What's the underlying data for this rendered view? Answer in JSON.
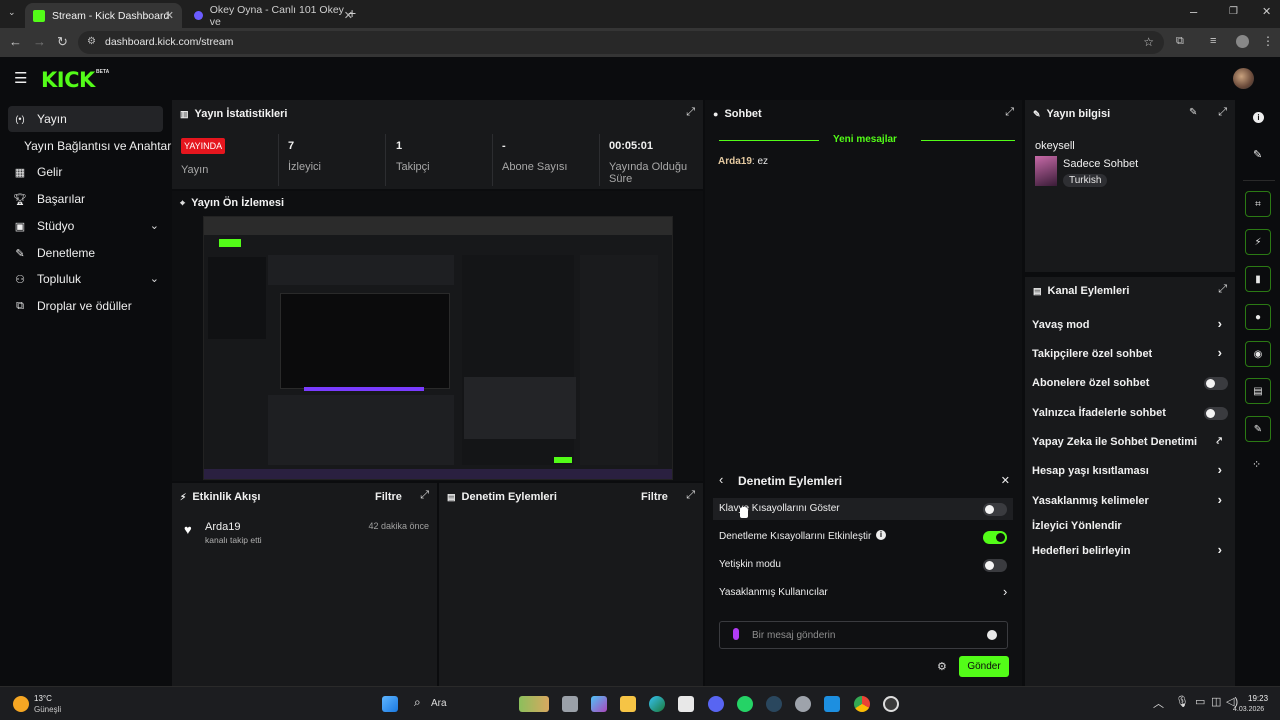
{
  "browser": {
    "tabs": [
      {
        "title": "Stream - Kick Dashboard",
        "active": true
      },
      {
        "title": "Okey Oyna - Canlı 101 Okey ve",
        "active": false
      }
    ],
    "url": "dashboard.kick.com/stream"
  },
  "brand": {
    "logo": "KICK",
    "beta": "BETA",
    "accent": "#53fc18"
  },
  "sidebar": {
    "items": [
      {
        "label": "Yayın",
        "icon": "broadcast-icon",
        "active": true
      },
      {
        "label": "Yayın Bağlantısı ve Anahtarı",
        "icon": "",
        "active": false
      },
      {
        "label": "Gelir",
        "icon": "revenue-icon"
      },
      {
        "label": "Başarılar",
        "icon": "trophy-icon"
      },
      {
        "label": "Stüdyo",
        "icon": "studio-icon",
        "expandable": true
      },
      {
        "label": "Denetleme",
        "icon": "moderation-icon"
      },
      {
        "label": "Topluluk",
        "icon": "community-icon",
        "expandable": true
      },
      {
        "label": "Droplar ve ödüller",
        "icon": "drops-icon"
      }
    ]
  },
  "stats": {
    "title": "Yayın İstatistikleri",
    "live_badge": "YAYINDA",
    "live_label": "Yayın",
    "viewers": {
      "value": "7",
      "label": "İzleyici"
    },
    "followers": {
      "value": "1",
      "label": "Takipçi"
    },
    "subs": {
      "value": "-",
      "label": "Abone Sayısı"
    },
    "uptime": {
      "value": "00:05:01",
      "label": "Yayında Olduğu Süre"
    }
  },
  "preview": {
    "title": "Yayın Ön İzlemesi"
  },
  "activity": {
    "title": "Etkinlik Akışı",
    "filter": "Filtre",
    "items": [
      {
        "user": "Arda19",
        "text": "kanalı takip etti",
        "time": "42 dakika önce"
      }
    ]
  },
  "modlog": {
    "title": "Denetim Eylemleri",
    "filter": "Filtre"
  },
  "chat": {
    "title": "Sohbet",
    "new_messages": "Yeni mesajlar",
    "messages": [
      {
        "user": "Arda19",
        "text": "ez"
      }
    ],
    "mod_panel": {
      "title": "Denetim Eylemleri",
      "rows": [
        {
          "label": "Klavye Kısayollarını Göster",
          "type": "toggle",
          "on": false
        },
        {
          "label": "Denetleme Kısayollarını Etkinleştir",
          "type": "toggle",
          "on": true
        },
        {
          "label": "Yetişkin modu",
          "type": "toggle",
          "on": false
        },
        {
          "label": "Yasaklanmış Kullanıcılar",
          "type": "arrow"
        }
      ]
    },
    "input_placeholder": "Bir mesaj gönderin",
    "send": "Gönder"
  },
  "stream_info": {
    "title": "Yayın bilgisi",
    "stream_title": "okeysell",
    "category": "Sadece Sohbet",
    "tag": "Turkish"
  },
  "channel_actions": {
    "title": "Kanal Eylemleri",
    "rows": [
      {
        "label": "Yavaş mod",
        "type": "arrow"
      },
      {
        "label": "Takipçilere özel sohbet",
        "type": "arrow"
      },
      {
        "label": "Abonelere özel sohbet",
        "type": "toggle",
        "on": false
      },
      {
        "label": "Yalnızca İfadelerle sohbet",
        "type": "toggle",
        "on": false
      },
      {
        "label": "Yapay Zeka ile Sohbet Denetimi",
        "type": "external"
      },
      {
        "label": "Hesap yaşı kısıtlaması",
        "type": "arrow"
      },
      {
        "label": "Yasaklanmış kelimeler",
        "type": "arrow"
      },
      {
        "label": "İzleyici Yönlendir",
        "type": "none"
      },
      {
        "label": "Hedefleri belirleyin",
        "type": "arrow"
      }
    ]
  },
  "taskbar": {
    "weather_temp": "13°C",
    "weather_desc": "Güneşli",
    "search": "Ara",
    "time": "19:23",
    "date": "4.03.2026"
  }
}
